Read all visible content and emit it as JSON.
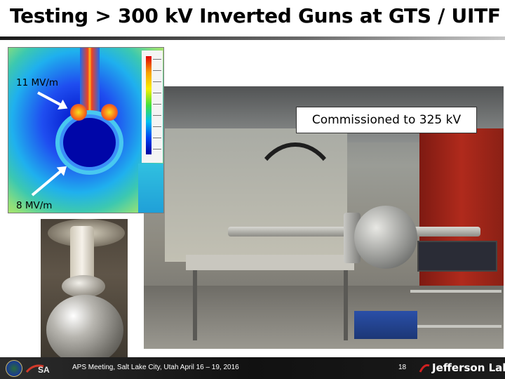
{
  "slide": {
    "title": "Testing > 300 kV Inverted Guns at GTS / UITF",
    "callout": "Commissioned to 325 kV",
    "field_labels": {
      "upper": "11 MV/m",
      "lower": "8 MV/m"
    },
    "images": {
      "simulation": "electric-field-simulation",
      "lab": "gun-test-stand-lab-photo",
      "inset": "inverted-gun-photo"
    }
  },
  "footer": {
    "conference": "APS Meeting, Salt Lake City, Utah  April 16 – 19, 2016",
    "page_number": "18",
    "brand": "Jefferson Lab",
    "logos": [
      "doe-seal",
      "jsa-logo",
      "jefferson-lab-logo"
    ]
  },
  "colors": {
    "title_rule": "#1a1a1a",
    "footer_bg": "#111111",
    "footer_text": "#ffffff"
  }
}
